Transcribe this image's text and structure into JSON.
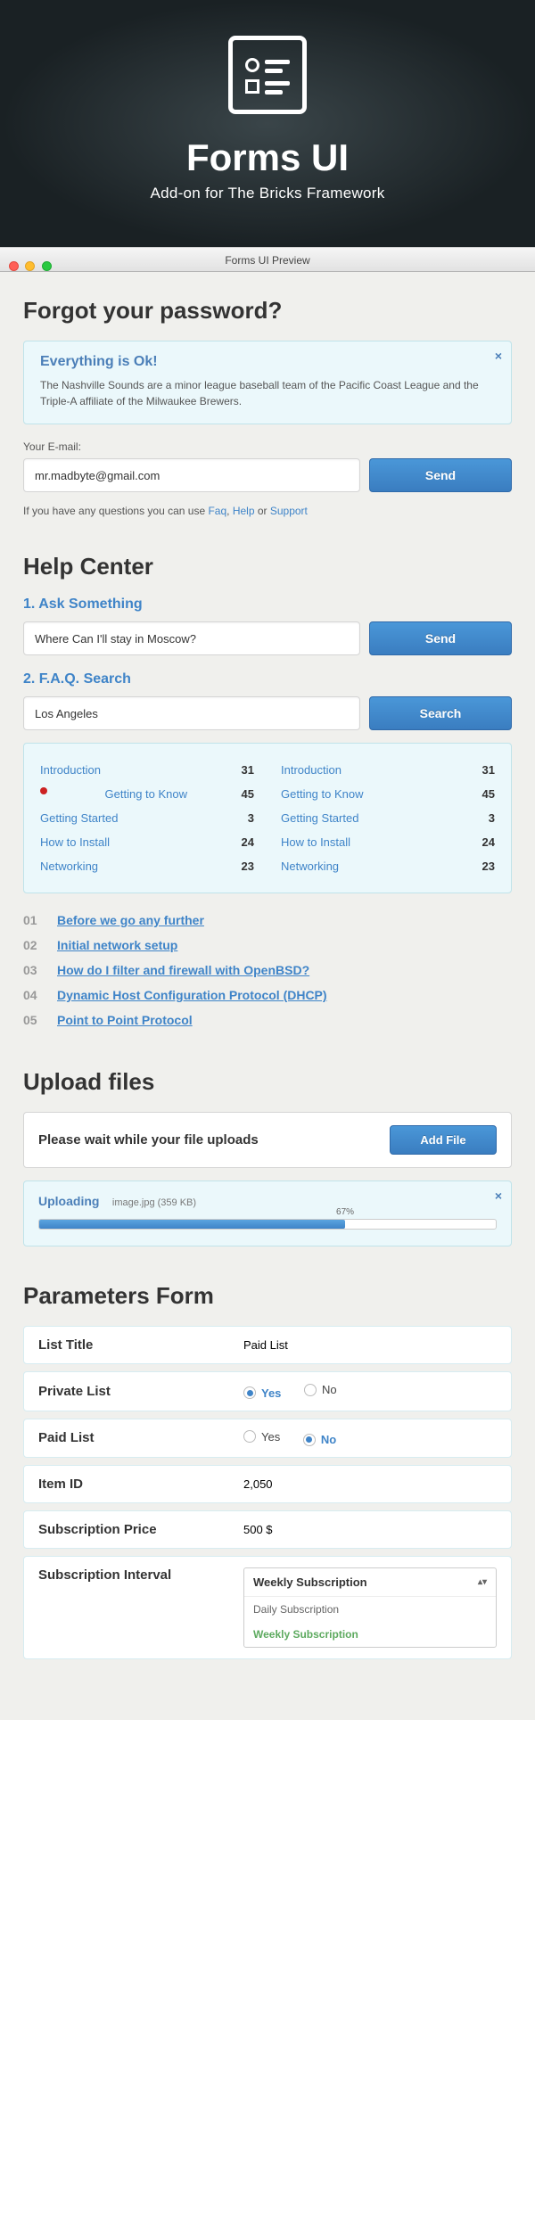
{
  "hero": {
    "title": "Forms UI",
    "subtitle": "Add-on for The Bricks Framework"
  },
  "window_title": "Forms UI Preview",
  "forgot": {
    "heading": "Forgot your password?",
    "alert_title": "Everything is Ok!",
    "alert_body": "The Nashville Sounds are a minor league baseball team of the Pacific Coast League and the Triple-A affiliate of the Milwaukee Brewers.",
    "email_label": "Your E-mail:",
    "email_value": "mr.madbyte@gmail.com",
    "send": "Send",
    "hint_prefix": "If you have any questions you can use ",
    "link_faq": "Faq",
    "link_help": "Help",
    "link_support": "Support"
  },
  "help": {
    "heading": "Help Center",
    "ask_title": "1. Ask Something",
    "ask_value": "Where Can I'll stay in Moscow?",
    "ask_btn": "Send",
    "faq_title": "2. F.A.Q. Search",
    "faq_value": "Los Angeles",
    "faq_btn": "Search",
    "col1": [
      {
        "label": "Introduction",
        "n": "31"
      },
      {
        "label": "Getting to Know",
        "n": "45",
        "pin": true
      },
      {
        "label": "Getting Started",
        "n": "3"
      },
      {
        "label": "How to Install",
        "n": "24"
      },
      {
        "label": "Networking",
        "n": "23"
      }
    ],
    "col2": [
      {
        "label": "Introduction",
        "n": "31"
      },
      {
        "label": "Getting to Know",
        "n": "45"
      },
      {
        "label": "Getting Started",
        "n": "3"
      },
      {
        "label": "How to Install",
        "n": "24"
      },
      {
        "label": "Networking",
        "n": "23"
      }
    ],
    "articles": [
      {
        "no": "01",
        "t": "Before we go any further"
      },
      {
        "no": "02",
        "t": "Initial network setup"
      },
      {
        "no": "03",
        "t": "How do I filter and firewall with OpenBSD?"
      },
      {
        "no": "04",
        "t": "Dynamic Host Configuration Protocol (DHCP)"
      },
      {
        "no": "05",
        "t": "Point to Point Protocol"
      }
    ]
  },
  "upload": {
    "heading": "Upload files",
    "wait": "Please wait while your file uploads",
    "add": "Add File",
    "status": "Uploading",
    "filename": "image.jpg (359 KB)",
    "pct_label": "67%",
    "pct": 67
  },
  "params": {
    "heading": "Parameters Form",
    "rows": {
      "list_title": {
        "label": "List Title",
        "value": "Paid List"
      },
      "private_list": {
        "label": "Private List",
        "yes": "Yes",
        "no": "No",
        "sel": "yes"
      },
      "paid_list": {
        "label": "Paid List",
        "yes": "Yes",
        "no": "No",
        "sel": "no"
      },
      "item_id": {
        "label": "Item ID",
        "value": "2,050"
      },
      "sub_price": {
        "label": "Subscription Price",
        "value": "500 $"
      },
      "sub_interval": {
        "label": "Subscription Interval",
        "value": "Weekly Subscription",
        "opts": [
          "Daily Subscription",
          "Weekly Subscription"
        ]
      }
    }
  }
}
